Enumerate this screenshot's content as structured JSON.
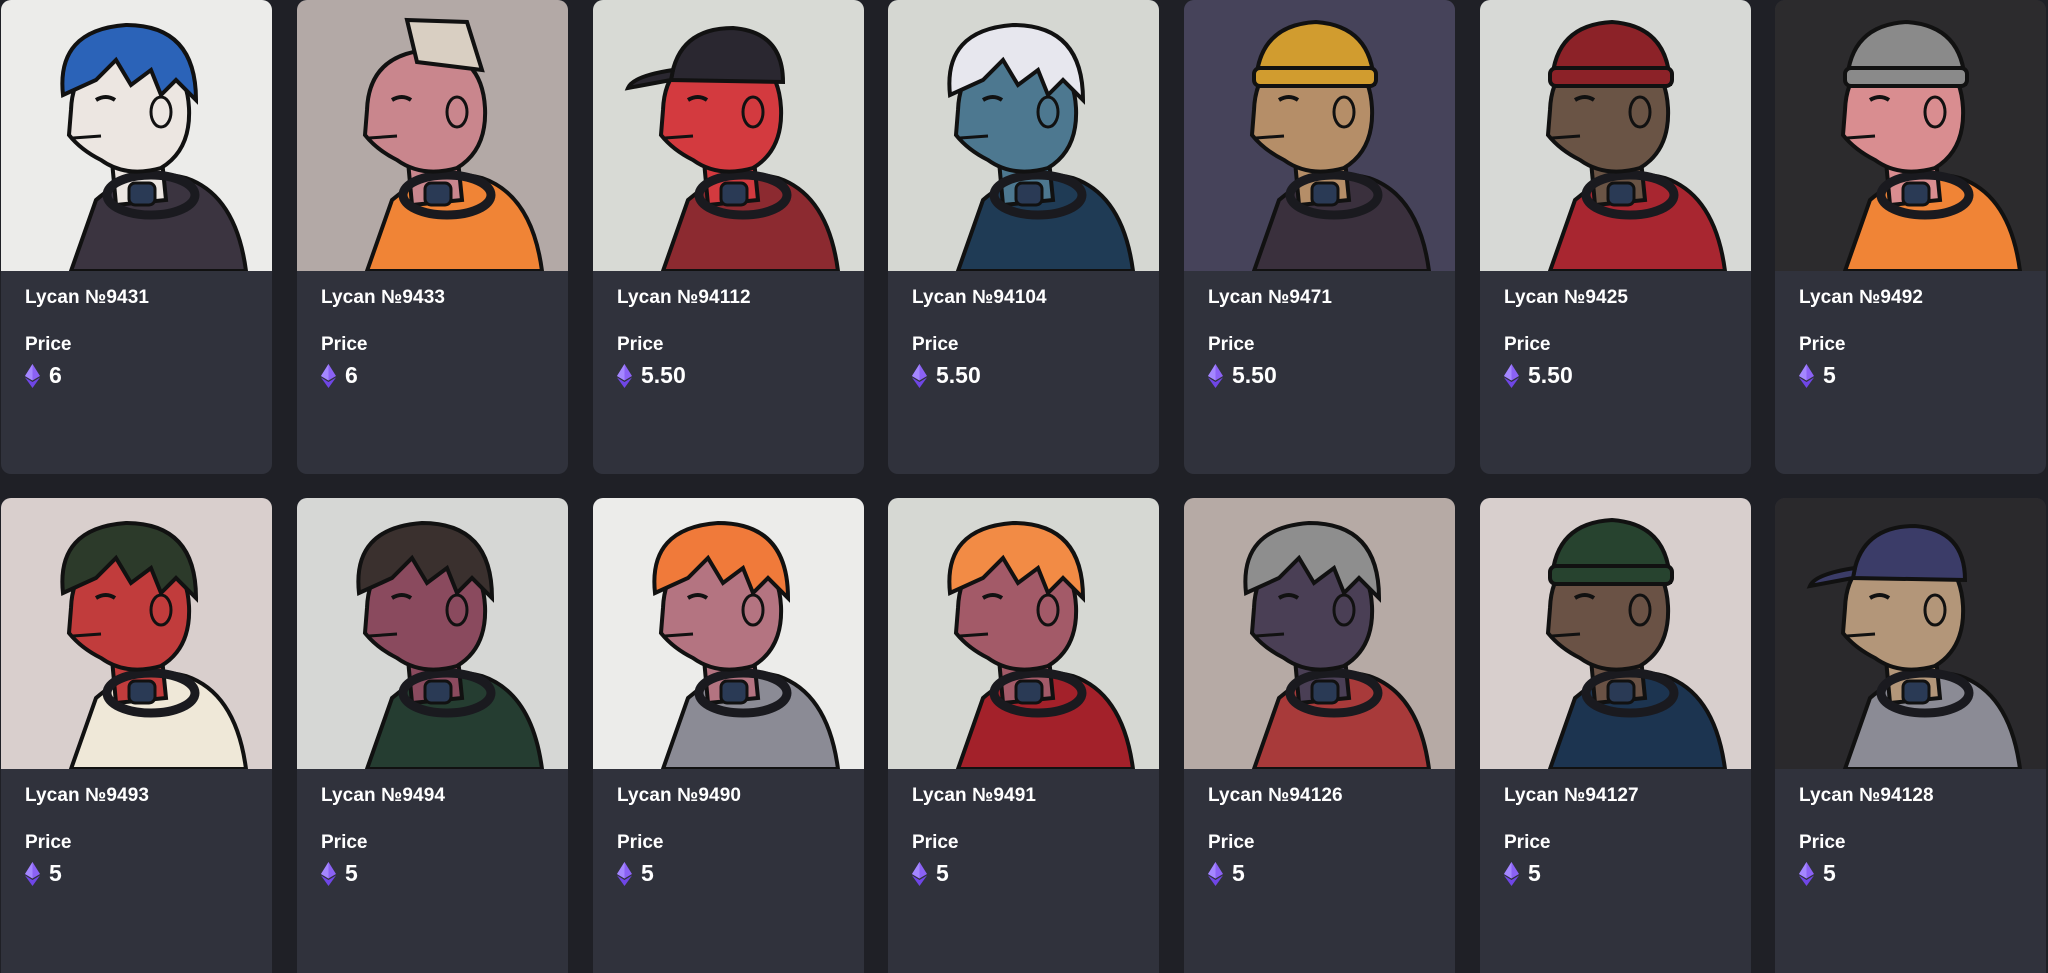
{
  "price_label": "Price",
  "currency_icon": "ethereum-icon",
  "colors": {
    "page_bg": "#1f2026",
    "card_bg": "#30323c",
    "eth_purple": "#7f56f0"
  },
  "items": [
    {
      "name": "Lycan №9431",
      "price": "6",
      "bg": "#ececea",
      "hair": "#2b63b8",
      "skin": "#ece6e1",
      "top": "#3b3440",
      "hat": "none"
    },
    {
      "name": "Lycan №9433",
      "price": "6",
      "bg": "#b3a9a6",
      "hair": "#d9cfc2",
      "skin": "#c9868d",
      "top": "#f08436",
      "hat": "mohawk"
    },
    {
      "name": "Lycan №94112",
      "price": "5.50",
      "bg": "#d8dad5",
      "hair": "#2a2730",
      "skin": "#d33a3f",
      "top": "#8c2a30",
      "hat": "cap"
    },
    {
      "name": "Lycan №94104",
      "price": "5.50",
      "bg": "#d5d7d2",
      "hair": "#e7e7ee",
      "skin": "#4d7890",
      "top": "#1f3b55",
      "hat": "none"
    },
    {
      "name": "Lycan №9471",
      "price": "5.50",
      "bg": "#46435a",
      "hair": "#d19c2f",
      "skin": "#b58e68",
      "top": "#3a303d",
      "hat": "beanie"
    },
    {
      "name": "Lycan №9425",
      "price": "5.50",
      "bg": "#d7d9d6",
      "hair": "#8c2228",
      "skin": "#6a5445",
      "top": "#a82630",
      "hat": "beanie"
    },
    {
      "name": "Lycan №9492",
      "price": "5",
      "bg": "#2c2b2d",
      "hair": "#8a8a8a",
      "skin": "#d98d90",
      "top": "#f08436",
      "hat": "beanie"
    },
    {
      "name": "Lycan №9493",
      "price": "5",
      "bg": "#d9cfcd",
      "hair": "#2c3a2a",
      "skin": "#c13c3c",
      "top": "#efe8d8",
      "hat": "none"
    },
    {
      "name": "Lycan №9494",
      "price": "5",
      "bg": "#d6d7d5",
      "hair": "#3a302e",
      "skin": "#8a4a5e",
      "top": "#253d31",
      "hat": "none"
    },
    {
      "name": "Lycan №9490",
      "price": "5",
      "bg": "#ececea",
      "hair": "#f07a3a",
      "skin": "#b47481",
      "top": "#8b8b95",
      "hat": "none"
    },
    {
      "name": "Lycan №9491",
      "price": "5",
      "bg": "#d6d8d3",
      "hair": "#f28b45",
      "skin": "#a35a68",
      "top": "#a3212a",
      "hat": "none"
    },
    {
      "name": "Lycan №94126",
      "price": "5",
      "bg": "#b6aaa5",
      "hair": "#8e8e8e",
      "skin": "#4a3f55",
      "top": "#a83a3a",
      "hat": "none"
    },
    {
      "name": "Lycan №94127",
      "price": "5",
      "bg": "#d8cfcd",
      "hair": "#27432f",
      "skin": "#6a5245",
      "top": "#1c3450",
      "hat": "beanie"
    },
    {
      "name": "Lycan №94128",
      "price": "5",
      "bg": "#2a292c",
      "hair": "#3b3c68",
      "skin": "#b39679",
      "top": "#8b8b95",
      "hat": "cap"
    }
  ]
}
